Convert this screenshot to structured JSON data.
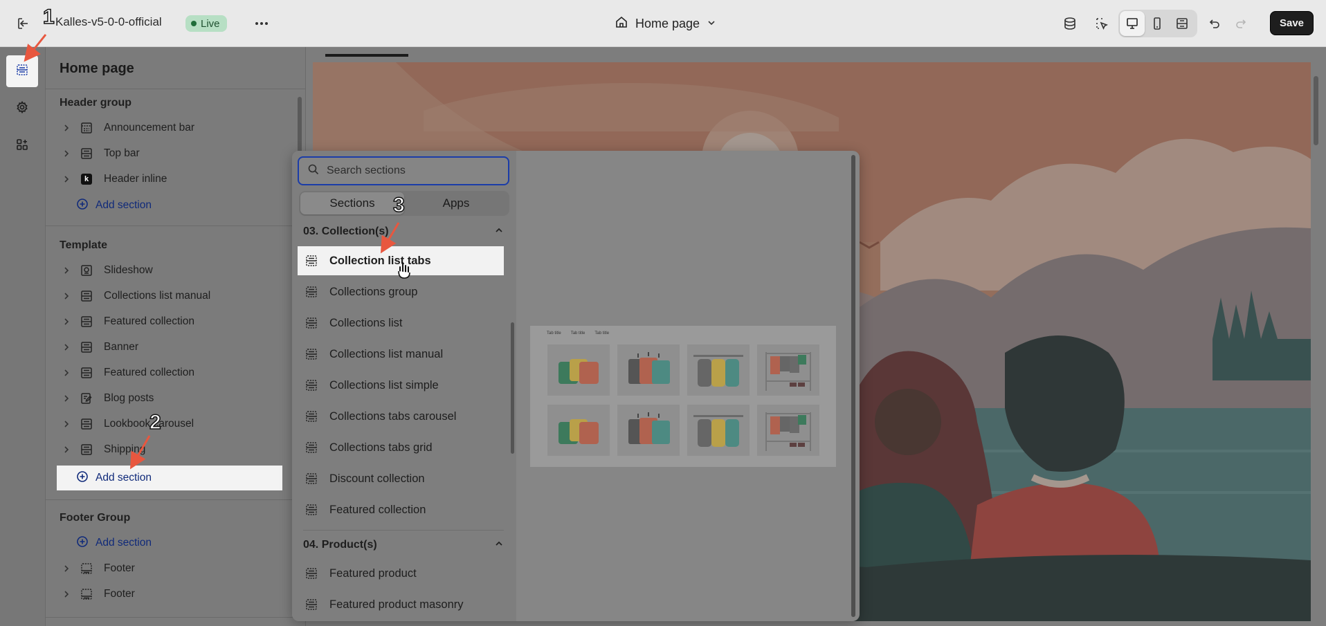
{
  "topbar": {
    "store_name": "Kalles-v5-0-0-official",
    "live_label": "Live",
    "more_label": "•••",
    "page_name": "Home page",
    "save_label": "Save"
  },
  "sidebar": {
    "title": "Home page",
    "header_group": {
      "title": "Header group",
      "items": [
        "Announcement bar",
        "Top bar",
        "Header inline"
      ],
      "add_label": "Add section"
    },
    "template": {
      "title": "Template",
      "items": [
        "Slideshow",
        "Collections list manual",
        "Featured collection",
        "Banner",
        "Featured collection",
        "Blog posts",
        "Lookbook carousel",
        "Shipping"
      ],
      "add_label": "Add section"
    },
    "footer_group": {
      "title": "Footer Group",
      "add_label": "Add section",
      "items": [
        "Footer",
        "Footer"
      ]
    },
    "header_badge": "k"
  },
  "picker": {
    "search_placeholder": "Search sections",
    "tabs": [
      "Sections",
      "Apps"
    ],
    "category_1": "03. Collection(s)",
    "items_1": [
      "Collection list tabs",
      "Collections group",
      "Collections list",
      "Collections list manual",
      "Collections list simple",
      "Collections tabs carousel",
      "Collections tabs grid",
      "Discount collection",
      "Featured collection"
    ],
    "category_2": "04. Product(s)",
    "items_2": [
      "Featured product",
      "Featured product masonry"
    ],
    "preview_tabs": [
      "Tab title",
      "Tab title",
      "Tab title"
    ]
  },
  "annotations": [
    "1",
    "2",
    "3"
  ],
  "colors": {
    "accent_blue": "#1b3ca8",
    "live_green": "#b7dfc4",
    "save_dark": "#1e1e1e",
    "annotation_arrow": "#e8573f"
  }
}
